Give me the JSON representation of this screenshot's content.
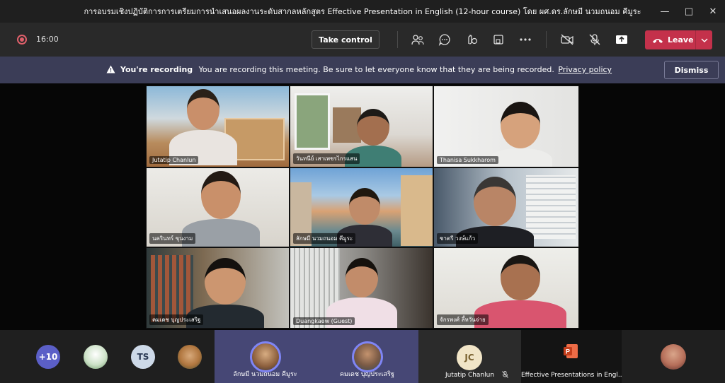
{
  "window": {
    "title": "การอบรมเชิงปฏิบัติการการเตรียมการนำเสนอผลงานระดับสากลหลักสูตร Effective Presentation in English (12-hour course) โดย ผศ.ดร.ลักษมี นวมถนอม คีมูระ"
  },
  "toolbar": {
    "timer": "16:00",
    "take_control": "Take control",
    "leave": "Leave"
  },
  "banner": {
    "heading": "You're recording",
    "message": "You are recording this meeting. Be sure to let everyone know that they are being recorded.",
    "link": "Privacy policy",
    "dismiss": "Dismiss"
  },
  "participants": [
    {
      "name": "Jutatip Chanlun"
    },
    {
      "name": "วันทนีย์ เสาเพชรไกรแสน"
    },
    {
      "name": "Thanisa Sukkharom"
    },
    {
      "name": "นครินทร์ ขุนงาม"
    },
    {
      "name": "ลักษมี นวมถนอม คีมูระ"
    },
    {
      "name": "ชาตรี วงษ์แก้ว"
    },
    {
      "name": "คมเดช บุญประเสริฐ"
    },
    {
      "name": "Duangkaew (Guest)"
    },
    {
      "name": "จักรพงศ์ ลี้หวันจ่าย"
    }
  ],
  "bottom_bar": {
    "overflow_count": "+10",
    "ts_initials": "TS",
    "tiles": [
      {
        "name": "ลักษมี นวมถนอม คีมูระ"
      },
      {
        "name": "คมเดช บุญประเสริฐ"
      },
      {
        "name": "Jutatip Chanlun",
        "initials": "JC"
      },
      {
        "name": "Effective Presentations in Engl..."
      }
    ]
  }
}
